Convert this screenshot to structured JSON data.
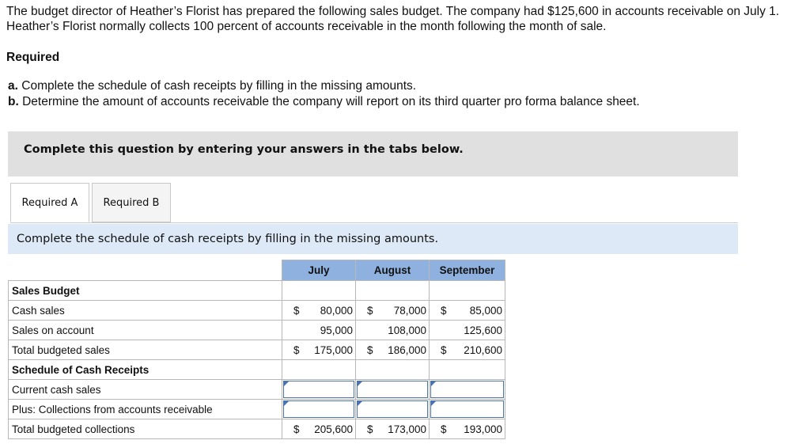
{
  "intro": "The budget director of Heather’s Florist has prepared the following sales budget. The company had $125,600 in accounts receivable on July 1. Heather’s Florist normally collects 100 percent of accounts receivable in the month following the month of sale.",
  "required_heading": "Required",
  "req_a": {
    "letter": "a.",
    "text": "Complete the schedule of cash receipts by filling in the missing amounts."
  },
  "req_b": {
    "letter": "b.",
    "text": "Determine the amount of accounts receivable the company will report on its third quarter pro forma balance sheet."
  },
  "banner": "Complete this question by entering your answers in the tabs below.",
  "tabs": [
    "Required A",
    "Required B"
  ],
  "instruction": "Complete the schedule of cash receipts by filling in the missing amounts.",
  "table": {
    "headers": [
      "July",
      "August",
      "September"
    ],
    "sales_budget_label": "Sales Budget",
    "cash_sales": {
      "label": "Cash sales",
      "values": [
        "80,000",
        "78,000",
        "85,000"
      ]
    },
    "sales_on_account": {
      "label": "Sales on account",
      "values": [
        "95,000",
        "108,000",
        "125,600"
      ]
    },
    "total_sales": {
      "label": "Total budgeted sales",
      "values": [
        "175,000",
        "186,000",
        "210,600"
      ]
    },
    "schedule_label": "Schedule of Cash Receipts",
    "current_cash_sales": {
      "label": "Current cash sales"
    },
    "collections": {
      "label": "Plus: Collections from accounts receivable"
    },
    "total_collections": {
      "label": "Total budgeted collections",
      "values": [
        "205,600",
        "173,000",
        "193,000"
      ]
    },
    "currency": "$"
  },
  "colors": {
    "header_bg": "#8fb1e0",
    "banner_bg": "#e0e0e0",
    "instruction_bg": "#dde9f6",
    "input_border": "#4a73b0"
  }
}
